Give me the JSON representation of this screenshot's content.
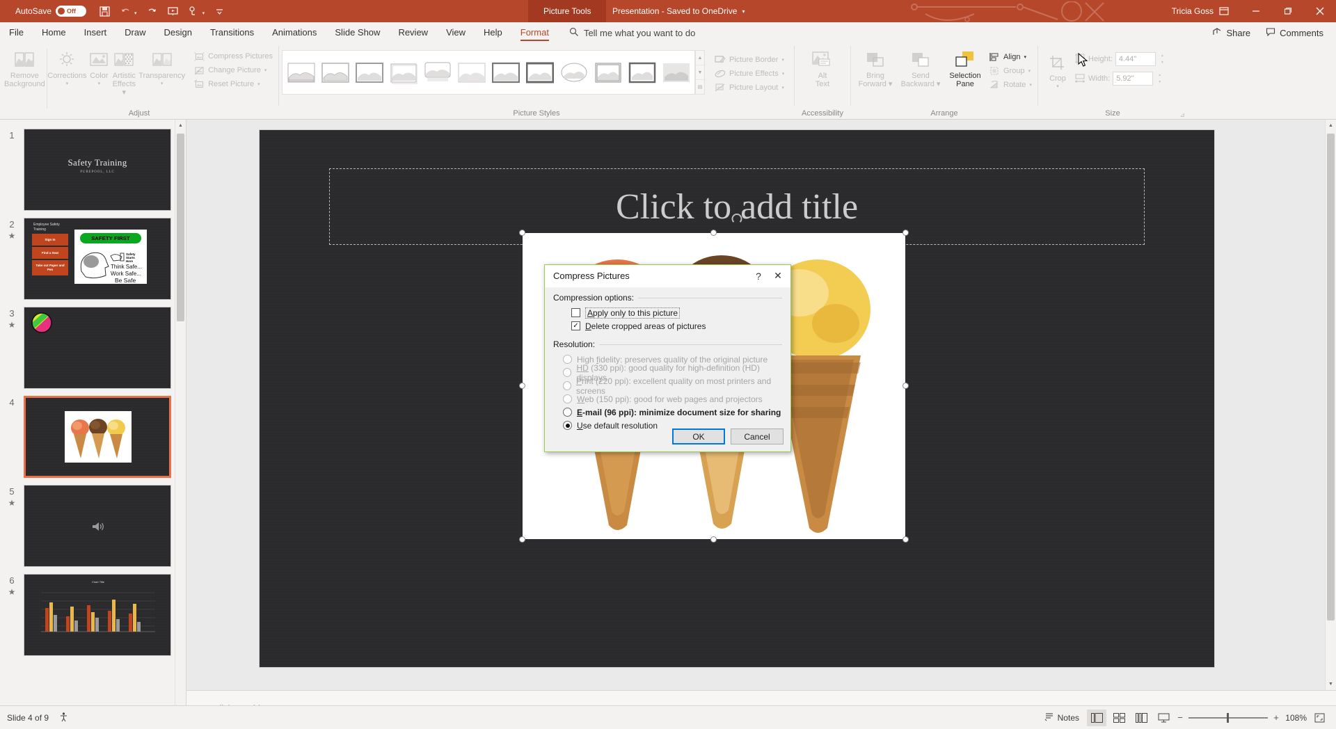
{
  "titlebar": {
    "autosave_label": "AutoSave",
    "autosave_state": "Off",
    "context_tab": "Picture Tools",
    "document_name": "Presentation  -  Saved to OneDrive",
    "user_name": "Tricia Goss",
    "qat_icons": [
      "save-icon",
      "undo-icon",
      "redo-icon",
      "start-slideshow-icon",
      "touch-mode-icon",
      "customize-qat-icon"
    ],
    "window_buttons": [
      "ribbon-display-options",
      "minimize",
      "restore",
      "close"
    ],
    "brand_color": "#b7472a"
  },
  "menubar": {
    "tabs": [
      {
        "label": "File",
        "active": false
      },
      {
        "label": "Home",
        "active": false
      },
      {
        "label": "Insert",
        "active": false
      },
      {
        "label": "Draw",
        "active": false
      },
      {
        "label": "Design",
        "active": false
      },
      {
        "label": "Transitions",
        "active": false
      },
      {
        "label": "Animations",
        "active": false
      },
      {
        "label": "Slide Show",
        "active": false
      },
      {
        "label": "Review",
        "active": false
      },
      {
        "label": "View",
        "active": false
      },
      {
        "label": "Help",
        "active": false
      },
      {
        "label": "Format",
        "active": true
      }
    ],
    "tellme_placeholder": "Tell me what you want to do",
    "share_label": "Share",
    "comments_label": "Comments"
  },
  "ribbon": {
    "groups": [
      {
        "name": "Adjust",
        "label": "Adjust",
        "big_buttons": [
          {
            "label_line1": "Remove",
            "label_line2": "Background",
            "icon": "remove-background-icon",
            "enabled": false
          },
          {
            "label_line1": "Corrections",
            "label_line2": "",
            "icon": "corrections-icon",
            "caret": true,
            "enabled": false
          },
          {
            "label_line1": "Color",
            "label_line2": "",
            "icon": "color-icon",
            "caret": true,
            "enabled": false
          },
          {
            "label_line1": "Artistic",
            "label_line2": "Effects",
            "icon": "artistic-effects-icon",
            "caret": true,
            "enabled": false
          },
          {
            "label_line1": "Transparency",
            "label_line2": "",
            "icon": "transparency-icon",
            "caret": true,
            "enabled": false
          }
        ],
        "small_buttons": [
          {
            "label": "Compress Pictures",
            "icon": "compress-pictures-icon",
            "enabled": false
          },
          {
            "label": "Change Picture",
            "icon": "change-picture-icon",
            "caret": true,
            "enabled": false
          },
          {
            "label": "Reset Picture",
            "icon": "reset-picture-icon",
            "caret": true,
            "enabled": false
          }
        ]
      },
      {
        "name": "Picture Styles",
        "label": "Picture Styles",
        "gallery_items": [
          "style-simple-frame",
          "style-beveled-matte",
          "style-metal-frame",
          "style-drop-shadow",
          "style-reflected-rounded",
          "style-soft-edge-oval",
          "style-perspective",
          "style-relaxed-perspective",
          "style-moderate-frame-black",
          "style-rotated-white",
          "style-thick-matte",
          "style-bevel-rectangle"
        ],
        "side_buttons": [
          {
            "label": "Picture Border",
            "icon": "picture-border-icon",
            "caret": true,
            "enabled": false
          },
          {
            "label": "Picture Effects",
            "icon": "picture-effects-icon",
            "caret": true,
            "enabled": false
          },
          {
            "label": "Picture Layout",
            "icon": "picture-layout-icon",
            "caret": true,
            "enabled": false
          }
        ]
      },
      {
        "name": "Accessibility",
        "label": "Accessibility",
        "big_buttons": [
          {
            "label_line1": "Alt",
            "label_line2": "Text",
            "icon": "alt-text-icon",
            "enabled": false
          }
        ]
      },
      {
        "name": "Arrange",
        "label": "Arrange",
        "big_buttons": [
          {
            "label_line1": "Bring",
            "label_line2": "Forward",
            "icon": "bring-forward-icon",
            "caret": true,
            "enabled": false
          },
          {
            "label_line1": "Send",
            "label_line2": "Backward",
            "icon": "send-backward-icon",
            "caret": true,
            "enabled": false
          },
          {
            "label_line1": "Selection",
            "label_line2": "Pane",
            "icon": "selection-pane-icon",
            "enabled": true,
            "hovered": true
          }
        ],
        "small_buttons": [
          {
            "label": "Align",
            "icon": "align-icon",
            "caret": true,
            "enabled": true
          },
          {
            "label": "Group",
            "icon": "group-icon",
            "caret": true,
            "enabled": false
          },
          {
            "label": "Rotate",
            "icon": "rotate-icon",
            "caret": true,
            "enabled": false
          }
        ]
      },
      {
        "name": "Size",
        "label": "Size",
        "crop_label": "Crop",
        "fields": [
          {
            "label": "Height:",
            "value": "4.44\"",
            "icon": "height-icon"
          },
          {
            "label": "Width:",
            "value": "5.92\"",
            "icon": "width-icon"
          }
        ]
      }
    ]
  },
  "thumbnails": [
    {
      "number": "1",
      "animated": false,
      "selected": false,
      "kind": "title",
      "title": "Safety Training",
      "subtitle": "PUREPOOL, LLC"
    },
    {
      "number": "2",
      "animated": true,
      "selected": false,
      "kind": "smartart",
      "heading": "Employee Safety Training",
      "blocks": [
        "Sign In",
        "Find a Seat",
        "Take out Paper and Pen"
      ],
      "image_caption": "SAFETY FIRST",
      "image_lines": [
        "Think Safe...",
        "Work Safe...",
        "Be Safe"
      ],
      "image_badge": "Safety Starts Here"
    },
    {
      "number": "3",
      "animated": true,
      "selected": false,
      "kind": "ball"
    },
    {
      "number": "4",
      "animated": false,
      "selected": true,
      "kind": "icecream"
    },
    {
      "number": "5",
      "animated": true,
      "selected": false,
      "kind": "audio"
    },
    {
      "number": "6",
      "animated": true,
      "selected": false,
      "kind": "chart",
      "chart_title": "Chart Title"
    }
  ],
  "slide": {
    "title_placeholder": "Click to add title",
    "picture_alt": "three-ice-cream-cones-picture",
    "selected": true
  },
  "notes": {
    "placeholder": "Click to add notes"
  },
  "statusbar": {
    "slide_indicator": "Slide 4 of 9",
    "accessibility_icon": "accessibility-checker-icon",
    "notes_label": "Notes",
    "views": [
      {
        "name": "normal-view",
        "active": true
      },
      {
        "name": "slide-sorter-view",
        "active": false
      },
      {
        "name": "reading-view",
        "active": false
      },
      {
        "name": "slide-show-view",
        "active": false
      }
    ],
    "zoom_level": "108%",
    "zoom_out": "−",
    "zoom_in": "+",
    "fit_to_window_icon": "fit-slide-to-window-icon"
  },
  "dialog": {
    "title": "Compress Pictures",
    "help_icon": "?",
    "close_icon": "✕",
    "compression_group_label": "Compression options:",
    "checkboxes": [
      {
        "label_pre": "",
        "accel": "A",
        "label_post": "pply only to this picture",
        "checked": false,
        "focused": true,
        "name": "apply-only-to-this-picture"
      },
      {
        "label_pre": "",
        "accel": "D",
        "label_post": "elete cropped areas of pictures",
        "checked": true,
        "focused": false,
        "name": "delete-cropped-areas"
      }
    ],
    "resolution_group_label": "Resolution:",
    "radios": [
      {
        "pre": "High ",
        "accel": "f",
        "post": "idelity: preserves quality of the original picture",
        "selected": false,
        "enabled": false,
        "bold": false,
        "name": "resolution-high-fidelity"
      },
      {
        "pre": "",
        "accel": "HD",
        "post": " (330 ppi): good quality for high-definition (HD) displays",
        "selected": false,
        "enabled": false,
        "bold": false,
        "name": "resolution-hd-330"
      },
      {
        "pre": "",
        "accel": "P",
        "post": "rint (220 ppi): excellent quality on most printers and screens",
        "selected": false,
        "enabled": false,
        "bold": false,
        "name": "resolution-print-220"
      },
      {
        "pre": "",
        "accel": "W",
        "post": "eb (150 ppi): good for web pages and projectors",
        "selected": false,
        "enabled": false,
        "bold": false,
        "name": "resolution-web-150"
      },
      {
        "pre": "",
        "accel": "E",
        "post": "-mail (96 ppi): minimize document size for sharing",
        "selected": false,
        "enabled": true,
        "bold": true,
        "name": "resolution-email-96"
      },
      {
        "pre": "",
        "accel": "U",
        "post": "se default resolution",
        "selected": true,
        "enabled": true,
        "bold": false,
        "name": "resolution-use-default"
      }
    ],
    "ok_label": "OK",
    "cancel_label": "Cancel"
  }
}
